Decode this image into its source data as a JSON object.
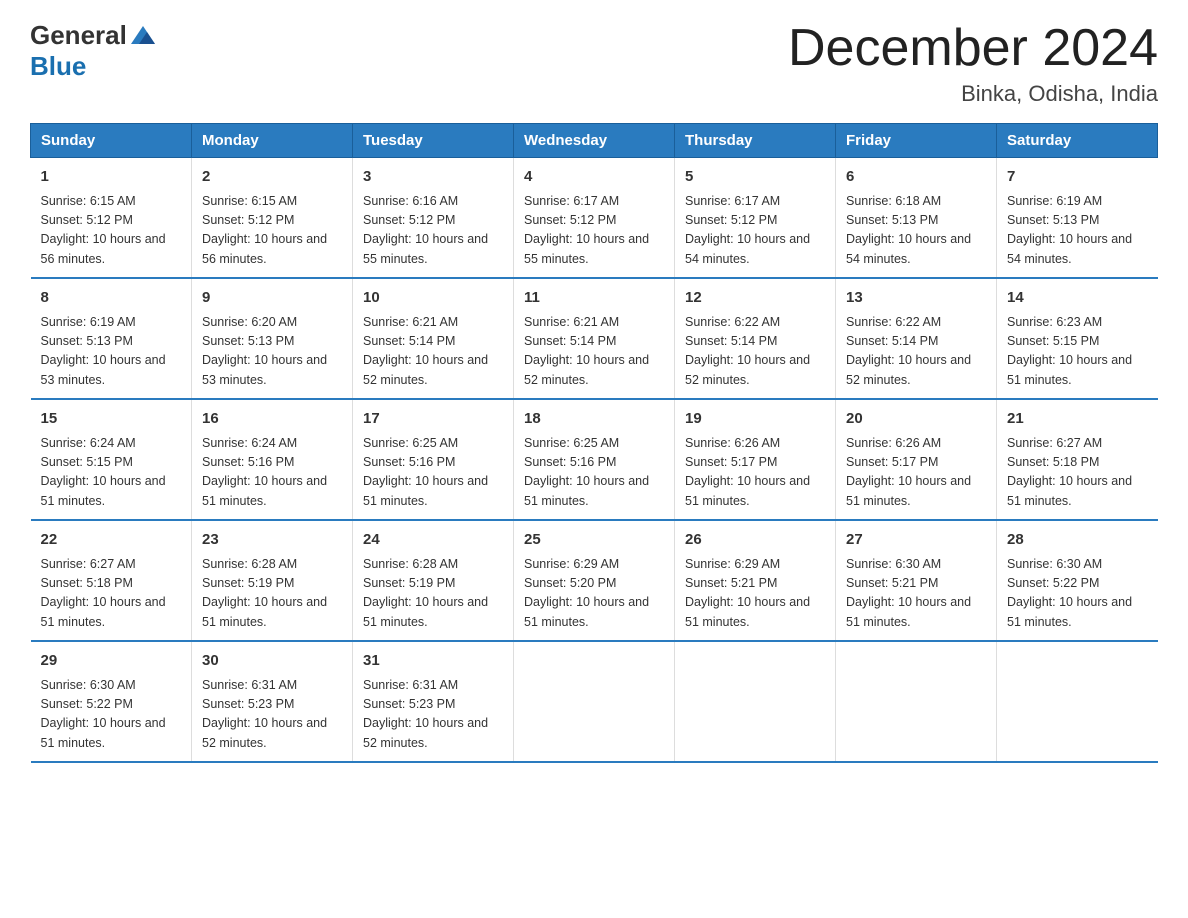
{
  "header": {
    "logo_general": "General",
    "logo_blue": "Blue",
    "month_title": "December 2024",
    "location": "Binka, Odisha, India"
  },
  "days_of_week": [
    "Sunday",
    "Monday",
    "Tuesday",
    "Wednesday",
    "Thursday",
    "Friday",
    "Saturday"
  ],
  "weeks": [
    [
      {
        "day": "1",
        "sunrise": "6:15 AM",
        "sunset": "5:12 PM",
        "daylight": "10 hours and 56 minutes."
      },
      {
        "day": "2",
        "sunrise": "6:15 AM",
        "sunset": "5:12 PM",
        "daylight": "10 hours and 56 minutes."
      },
      {
        "day": "3",
        "sunrise": "6:16 AM",
        "sunset": "5:12 PM",
        "daylight": "10 hours and 55 minutes."
      },
      {
        "day": "4",
        "sunrise": "6:17 AM",
        "sunset": "5:12 PM",
        "daylight": "10 hours and 55 minutes."
      },
      {
        "day": "5",
        "sunrise": "6:17 AM",
        "sunset": "5:12 PM",
        "daylight": "10 hours and 54 minutes."
      },
      {
        "day": "6",
        "sunrise": "6:18 AM",
        "sunset": "5:13 PM",
        "daylight": "10 hours and 54 minutes."
      },
      {
        "day": "7",
        "sunrise": "6:19 AM",
        "sunset": "5:13 PM",
        "daylight": "10 hours and 54 minutes."
      }
    ],
    [
      {
        "day": "8",
        "sunrise": "6:19 AM",
        "sunset": "5:13 PM",
        "daylight": "10 hours and 53 minutes."
      },
      {
        "day": "9",
        "sunrise": "6:20 AM",
        "sunset": "5:13 PM",
        "daylight": "10 hours and 53 minutes."
      },
      {
        "day": "10",
        "sunrise": "6:21 AM",
        "sunset": "5:14 PM",
        "daylight": "10 hours and 52 minutes."
      },
      {
        "day": "11",
        "sunrise": "6:21 AM",
        "sunset": "5:14 PM",
        "daylight": "10 hours and 52 minutes."
      },
      {
        "day": "12",
        "sunrise": "6:22 AM",
        "sunset": "5:14 PM",
        "daylight": "10 hours and 52 minutes."
      },
      {
        "day": "13",
        "sunrise": "6:22 AM",
        "sunset": "5:14 PM",
        "daylight": "10 hours and 52 minutes."
      },
      {
        "day": "14",
        "sunrise": "6:23 AM",
        "sunset": "5:15 PM",
        "daylight": "10 hours and 51 minutes."
      }
    ],
    [
      {
        "day": "15",
        "sunrise": "6:24 AM",
        "sunset": "5:15 PM",
        "daylight": "10 hours and 51 minutes."
      },
      {
        "day": "16",
        "sunrise": "6:24 AM",
        "sunset": "5:16 PM",
        "daylight": "10 hours and 51 minutes."
      },
      {
        "day": "17",
        "sunrise": "6:25 AM",
        "sunset": "5:16 PM",
        "daylight": "10 hours and 51 minutes."
      },
      {
        "day": "18",
        "sunrise": "6:25 AM",
        "sunset": "5:16 PM",
        "daylight": "10 hours and 51 minutes."
      },
      {
        "day": "19",
        "sunrise": "6:26 AM",
        "sunset": "5:17 PM",
        "daylight": "10 hours and 51 minutes."
      },
      {
        "day": "20",
        "sunrise": "6:26 AM",
        "sunset": "5:17 PM",
        "daylight": "10 hours and 51 minutes."
      },
      {
        "day": "21",
        "sunrise": "6:27 AM",
        "sunset": "5:18 PM",
        "daylight": "10 hours and 51 minutes."
      }
    ],
    [
      {
        "day": "22",
        "sunrise": "6:27 AM",
        "sunset": "5:18 PM",
        "daylight": "10 hours and 51 minutes."
      },
      {
        "day": "23",
        "sunrise": "6:28 AM",
        "sunset": "5:19 PM",
        "daylight": "10 hours and 51 minutes."
      },
      {
        "day": "24",
        "sunrise": "6:28 AM",
        "sunset": "5:19 PM",
        "daylight": "10 hours and 51 minutes."
      },
      {
        "day": "25",
        "sunrise": "6:29 AM",
        "sunset": "5:20 PM",
        "daylight": "10 hours and 51 minutes."
      },
      {
        "day": "26",
        "sunrise": "6:29 AM",
        "sunset": "5:21 PM",
        "daylight": "10 hours and 51 minutes."
      },
      {
        "day": "27",
        "sunrise": "6:30 AM",
        "sunset": "5:21 PM",
        "daylight": "10 hours and 51 minutes."
      },
      {
        "day": "28",
        "sunrise": "6:30 AM",
        "sunset": "5:22 PM",
        "daylight": "10 hours and 51 minutes."
      }
    ],
    [
      {
        "day": "29",
        "sunrise": "6:30 AM",
        "sunset": "5:22 PM",
        "daylight": "10 hours and 51 minutes."
      },
      {
        "day": "30",
        "sunrise": "6:31 AM",
        "sunset": "5:23 PM",
        "daylight": "10 hours and 52 minutes."
      },
      {
        "day": "31",
        "sunrise": "6:31 AM",
        "sunset": "5:23 PM",
        "daylight": "10 hours and 52 minutes."
      },
      null,
      null,
      null,
      null
    ]
  ]
}
